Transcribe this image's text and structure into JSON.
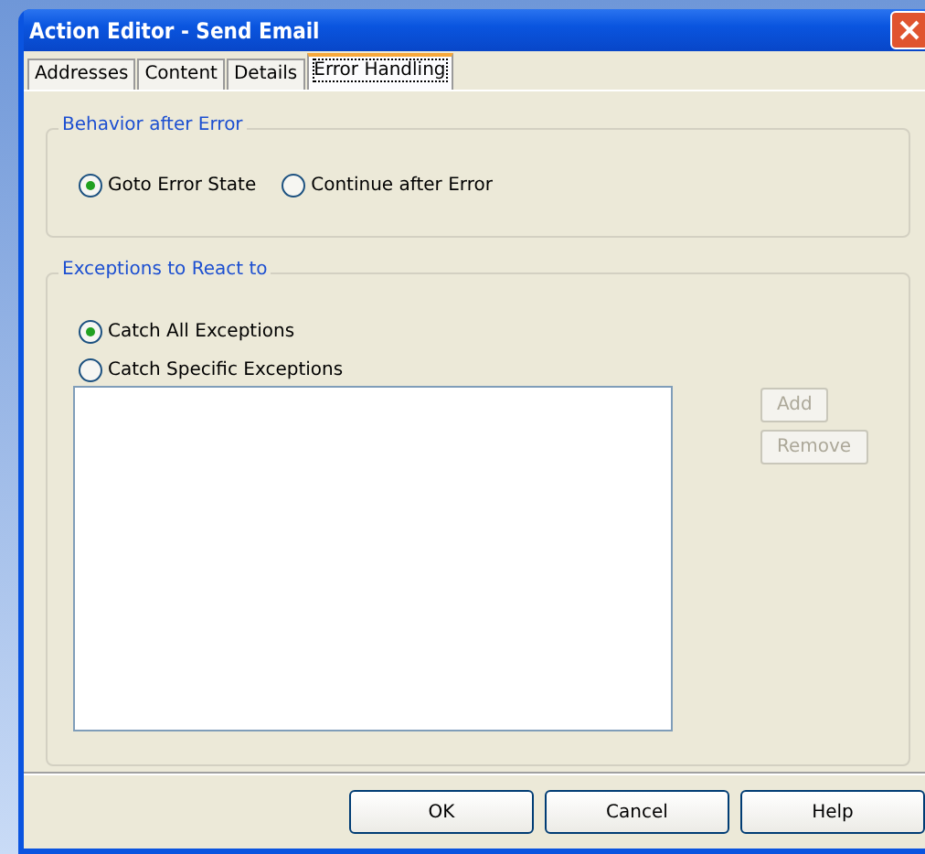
{
  "window": {
    "title": "Action Editor - Send Email"
  },
  "tabs": [
    {
      "label": "Addresses",
      "selected": false
    },
    {
      "label": "Content",
      "selected": false
    },
    {
      "label": "Details",
      "selected": false
    },
    {
      "label": "Error Handling",
      "selected": true
    }
  ],
  "behavior_group": {
    "title": "Behavior after Error",
    "options": [
      {
        "label": "Goto Error State",
        "selected": true
      },
      {
        "label": "Continue after Error",
        "selected": false
      }
    ]
  },
  "exceptions_group": {
    "title": "Exceptions to React to",
    "options": [
      {
        "label": "Catch All Exceptions",
        "selected": true
      },
      {
        "label": "Catch Specific Exceptions",
        "selected": false
      }
    ],
    "side_buttons": [
      {
        "label": "Add",
        "disabled": true
      },
      {
        "label": "Remove",
        "disabled": true
      }
    ]
  },
  "buttons": [
    "OK",
    "Cancel",
    "Help"
  ]
}
